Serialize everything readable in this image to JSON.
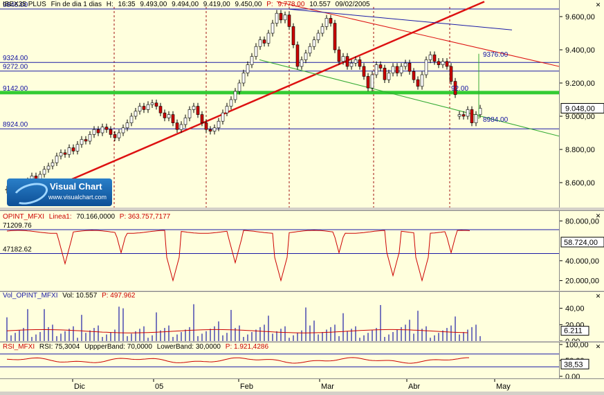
{
  "main": {
    "header": {
      "symbol": "IBEX35 PLUS",
      "period": "Fin de dia 1 dias",
      "h_label": "H:",
      "h_val": "16:35",
      "o_val": "9.493,00",
      "h2_val": "9.494,00",
      "l_val": "9.419,00",
      "c_val": "9.450,00",
      "p_label": "P:",
      "p_val": "9.778,00",
      "v_val": "10.557",
      "date": "09/02/2005"
    },
    "levels": [
      "9646.00",
      "9324.00",
      "9272.00",
      "9142.00",
      "8924.00"
    ],
    "annotations": [
      "9376.00",
      "8984.00",
      "92.00"
    ],
    "y_ticks": [
      "9.600,00",
      "9.400,00",
      "9.200,00",
      "9.000,00",
      "8.800,00",
      "8.600,00"
    ],
    "current": "9.048,00"
  },
  "logo": {
    "title": "Visual Chart",
    "url": "www.visualchart.com"
  },
  "oi": {
    "header": {
      "name": "OPINT_MFXI",
      "line": "Linea1:",
      "val": "70.166,0000",
      "p": "P: 363.757,7177"
    },
    "levels": [
      "71209.76",
      "47182.62"
    ],
    "y_ticks": [
      "80.000,00",
      "40.000,00",
      "20.000,00"
    ],
    "current": "58.724,00"
  },
  "vol": {
    "header": {
      "name": "Vol_OPINT_MFXI",
      "vol": "Vol: 10.557",
      "p": "P: 497.962"
    },
    "y_ticks": [
      "40,00",
      "20,00",
      "0,00"
    ],
    "current": "6.211"
  },
  "rsi": {
    "header": {
      "name": "RSI_MFXI",
      "rsi": "RSI: 75,3004",
      "upper": "UppperBand: 70,0000",
      "lower": "LowerBand: 30,0000",
      "p": "P: 1.921,4286"
    },
    "y_ticks": [
      "100,00",
      "50,00",
      "0,00"
    ],
    "current": "38,53"
  },
  "x_labels": [
    "Dic",
    "05",
    "Feb",
    "Mar",
    "Abr",
    "May"
  ],
  "chart_data": {
    "type": "candlestick",
    "title": "IBEX35 PLUS",
    "ylim": [
      8450,
      9700
    ],
    "candles": [
      {
        "o": 8555,
        "c": 8560
      },
      {
        "o": 8560,
        "c": 8575
      },
      {
        "o": 8570,
        "c": 8590
      },
      {
        "o": 8585,
        "c": 8600
      },
      {
        "o": 8600,
        "c": 8580
      },
      {
        "o": 8580,
        "c": 8610
      },
      {
        "o": 8610,
        "c": 8640
      },
      {
        "o": 8640,
        "c": 8620
      },
      {
        "o": 8620,
        "c": 8650
      },
      {
        "o": 8650,
        "c": 8680
      },
      {
        "o": 8680,
        "c": 8700
      },
      {
        "o": 8700,
        "c": 8720
      },
      {
        "o": 8720,
        "c": 8760
      },
      {
        "o": 8760,
        "c": 8780
      },
      {
        "o": 8780,
        "c": 8770
      },
      {
        "o": 8770,
        "c": 8810
      },
      {
        "o": 8810,
        "c": 8790
      },
      {
        "o": 8790,
        "c": 8830
      },
      {
        "o": 8830,
        "c": 8860
      },
      {
        "o": 8860,
        "c": 8850
      },
      {
        "o": 8850,
        "c": 8890
      },
      {
        "o": 8890,
        "c": 8920
      },
      {
        "o": 8920,
        "c": 8900
      },
      {
        "o": 8900,
        "c": 8935
      },
      {
        "o": 8935,
        "c": 8920
      },
      {
        "o": 8920,
        "c": 8890
      },
      {
        "o": 8890,
        "c": 8870
      },
      {
        "o": 8870,
        "c": 8900
      },
      {
        "o": 8900,
        "c": 8930
      },
      {
        "o": 8930,
        "c": 8960
      },
      {
        "o": 8960,
        "c": 9000
      },
      {
        "o": 9000,
        "c": 9030
      },
      {
        "o": 9030,
        "c": 9060
      },
      {
        "o": 9060,
        "c": 9040
      },
      {
        "o": 9040,
        "c": 9070
      },
      {
        "o": 9070,
        "c": 9080
      },
      {
        "o": 9080,
        "c": 9060
      },
      {
        "o": 9060,
        "c": 9020
      },
      {
        "o": 9020,
        "c": 8990
      },
      {
        "o": 8990,
        "c": 9010
      },
      {
        "o": 9010,
        "c": 8960
      },
      {
        "o": 8960,
        "c": 8920
      },
      {
        "o": 8920,
        "c": 8950
      },
      {
        "o": 8950,
        "c": 8990
      },
      {
        "o": 8990,
        "c": 9040
      },
      {
        "o": 9040,
        "c": 9060
      },
      {
        "o": 9060,
        "c": 9010
      },
      {
        "o": 9010,
        "c": 8960
      },
      {
        "o": 8960,
        "c": 8920
      },
      {
        "o": 8920,
        "c": 8910
      },
      {
        "o": 8910,
        "c": 8930
      },
      {
        "o": 8930,
        "c": 8970
      },
      {
        "o": 8970,
        "c": 9020
      },
      {
        "o": 9020,
        "c": 9060
      },
      {
        "o": 9060,
        "c": 9100
      },
      {
        "o": 9100,
        "c": 9150
      },
      {
        "o": 9150,
        "c": 9200
      },
      {
        "o": 9200,
        "c": 9260
      },
      {
        "o": 9260,
        "c": 9310
      },
      {
        "o": 9310,
        "c": 9360
      },
      {
        "o": 9360,
        "c": 9420
      },
      {
        "o": 9420,
        "c": 9460
      },
      {
        "o": 9460,
        "c": 9440
      },
      {
        "o": 9440,
        "c": 9500
      },
      {
        "o": 9500,
        "c": 9560
      },
      {
        "o": 9560,
        "c": 9620
      },
      {
        "o": 9620,
        "c": 9580
      },
      {
        "o": 9580,
        "c": 9610
      },
      {
        "o": 9610,
        "c": 9540
      },
      {
        "o": 9540,
        "c": 9430
      },
      {
        "o": 9430,
        "c": 9300
      },
      {
        "o": 9300,
        "c": 9340
      },
      {
        "o": 9340,
        "c": 9380
      },
      {
        "o": 9380,
        "c": 9420
      },
      {
        "o": 9420,
        "c": 9460
      },
      {
        "o": 9460,
        "c": 9500
      },
      {
        "o": 9500,
        "c": 9540
      },
      {
        "o": 9540,
        "c": 9590
      },
      {
        "o": 9590,
        "c": 9560
      },
      {
        "o": 9560,
        "c": 9400
      },
      {
        "o": 9400,
        "c": 9330
      },
      {
        "o": 9330,
        "c": 9360
      },
      {
        "o": 9360,
        "c": 9300
      },
      {
        "o": 9300,
        "c": 9320
      },
      {
        "o": 9320,
        "c": 9340
      },
      {
        "o": 9340,
        "c": 9300
      },
      {
        "o": 9300,
        "c": 9240
      },
      {
        "o": 9240,
        "c": 9170
      },
      {
        "o": 9170,
        "c": 9250
      },
      {
        "o": 9250,
        "c": 9310
      },
      {
        "o": 9310,
        "c": 9290
      },
      {
        "o": 9290,
        "c": 9220
      },
      {
        "o": 9220,
        "c": 9260
      },
      {
        "o": 9260,
        "c": 9300
      },
      {
        "o": 9300,
        "c": 9260
      },
      {
        "o": 9260,
        "c": 9300
      },
      {
        "o": 9300,
        "c": 9320
      },
      {
        "o": 9320,
        "c": 9270
      },
      {
        "o": 9270,
        "c": 9220
      },
      {
        "o": 9220,
        "c": 9180
      },
      {
        "o": 9180,
        "c": 9250
      },
      {
        "o": 9250,
        "c": 9340
      },
      {
        "o": 9340,
        "c": 9370
      },
      {
        "o": 9370,
        "c": 9330
      },
      {
        "o": 9330,
        "c": 9310
      },
      {
        "o": 9310,
        "c": 9330
      },
      {
        "o": 9330,
        "c": 9300
      },
      {
        "o": 9300,
        "c": 9210
      },
      {
        "o": 9210,
        "c": 9130
      },
      {
        "o": 9000,
        "c": 9010
      },
      {
        "o": 9010,
        "c": 9000
      },
      {
        "o": 9000,
        "c": 9040
      },
      {
        "o": 9040,
        "c": 8960
      },
      {
        "o": 8960,
        "c": 9010
      },
      {
        "o": 9010,
        "c": 9048
      }
    ],
    "opint_series": "shown as line; spikes down at dips",
    "x_labels": [
      "Dic",
      "05",
      "Feb",
      "Mar",
      "Abr",
      "May"
    ]
  },
  "colors": {
    "up": "#ffffff",
    "down": "#cc0000",
    "level": "#1a1aa6",
    "support": "#33cc33",
    "trend": "#dd1111"
  }
}
